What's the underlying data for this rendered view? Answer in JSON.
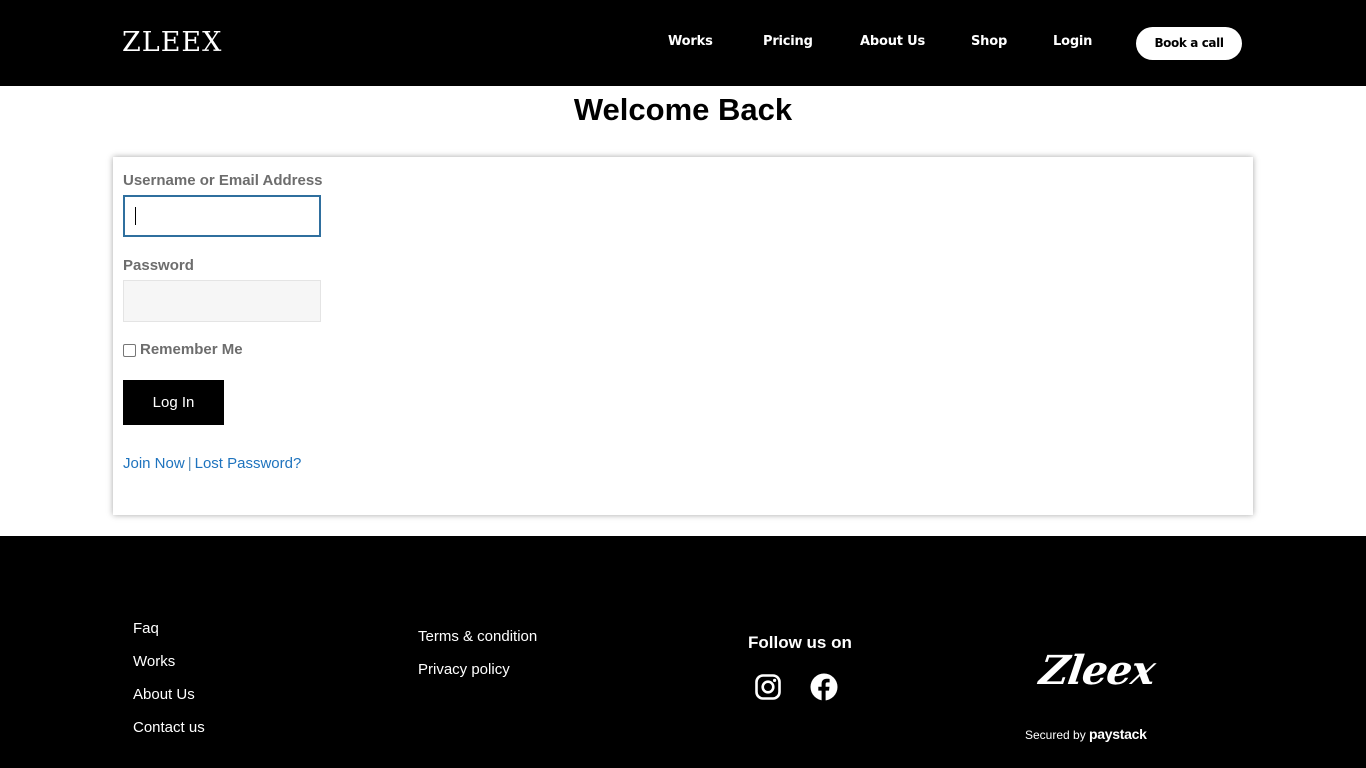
{
  "header": {
    "logo": "ZLEEX",
    "nav": [
      "Works",
      "Pricing",
      "About Us",
      "Shop",
      "Login"
    ],
    "cta": "Book a call"
  },
  "main": {
    "title": "Welcome Back",
    "form": {
      "username_label": "Username or Email Address",
      "username_value": "",
      "password_label": "Password",
      "password_value": "",
      "remember_label": "Remember Me",
      "remember_checked": false,
      "submit_label": "Log In",
      "join_link": "Join Now",
      "separator": "|",
      "lost_password_link": "Lost Password?"
    }
  },
  "footer": {
    "col1": [
      "Faq",
      "Works",
      "About Us",
      "Contact us"
    ],
    "col2": [
      "Terms & condition",
      "Privacy policy"
    ],
    "follow_title": "Follow us on",
    "social_icons": [
      "instagram-icon",
      "facebook-icon"
    ],
    "brand_script": "Zleex",
    "secured_prefix": "Secured by",
    "secured_brand": "paystack"
  },
  "colors": {
    "header_bg": "#000000",
    "footer_bg": "#000000",
    "link": "#1e73be",
    "label": "#6d6d6d",
    "focus_border": "#2f6f9e"
  }
}
